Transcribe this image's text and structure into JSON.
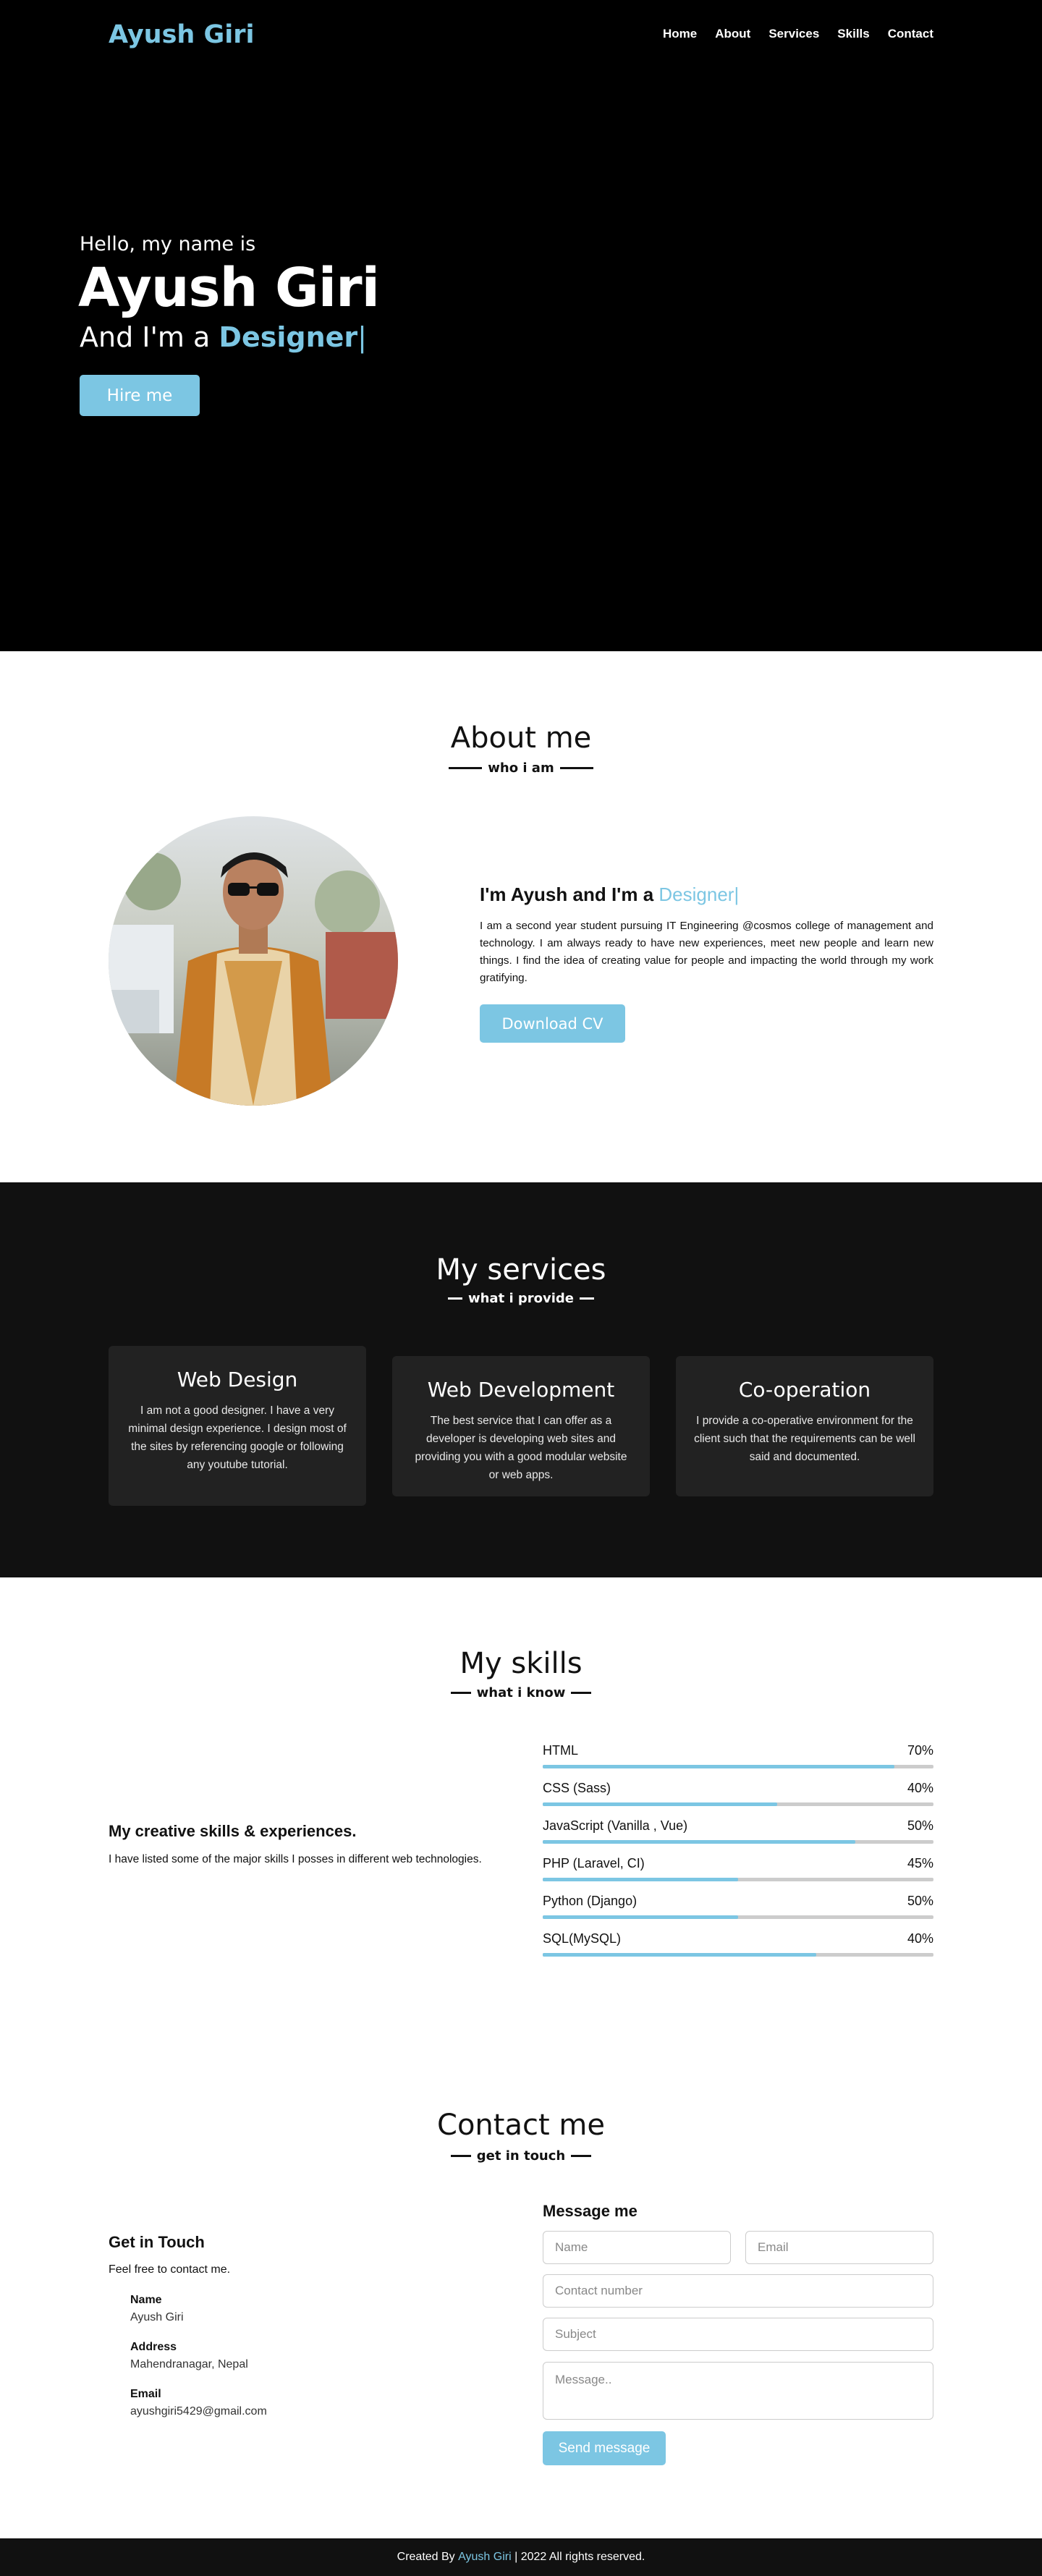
{
  "brand": {
    "name": "Ayush Giri",
    "accent": "#7cc6e3"
  },
  "nav": {
    "items": [
      "Home",
      "About",
      "Services",
      "Skills",
      "Contact"
    ]
  },
  "hero": {
    "greeting": "Hello, my name is",
    "name": "Ayush Giri",
    "role_prefix": "And I'm a",
    "role_typed": "Designer",
    "cursor": "|",
    "hire_label": "Hire me"
  },
  "about": {
    "title": "About me",
    "subtitle": "who i am",
    "heading_prefix": "I'm Ayush and I'm a",
    "heading_typed": "Designer|",
    "paragraph": "I am a second year student pursuing IT Engineering @cosmos college of management and technology. I am always ready to have new experiences, meet new people and learn new things. I find the idea of creating value for people and impacting the world through my work gratifying.",
    "cv_label": "Download CV"
  },
  "services": {
    "title": "My services",
    "subtitle": "what i provide",
    "cards": [
      {
        "title": "Web Design",
        "text": "I am not a good designer. I have a very minimal design experience. I design most of the sites by referencing google or following any youtube tutorial."
      },
      {
        "title": "Web Development",
        "text": "The best service that I can offer as a developer is developing web sites and providing you with a good modular website or web apps."
      },
      {
        "title": "Co-operation",
        "text": "I provide a co-operative environment for the client such that the requirements can be well said and documented."
      }
    ]
  },
  "skills": {
    "title": "My skills",
    "subtitle": "what i know",
    "heading": "My creative skills & experiences.",
    "paragraph": "I have listed some of the major skills I posses in different web technologies.",
    "items": [
      {
        "name": "HTML",
        "label": "70%",
        "percent": 90
      },
      {
        "name": "CSS (Sass)",
        "label": "40%",
        "percent": 60
      },
      {
        "name": "JavaScript (Vanilla , Vue)",
        "label": "50%",
        "percent": 80
      },
      {
        "name": "PHP (Laravel, CI)",
        "label": "45%",
        "percent": 50
      },
      {
        "name": "Python (Django)",
        "label": "50%",
        "percent": 50
      },
      {
        "name": "SQL(MySQL)",
        "label": "40%",
        "percent": 70
      }
    ]
  },
  "contact": {
    "title": "Contact me",
    "subtitle": "get in touch",
    "heading": "Get in Touch",
    "lead": "Feel free to contact me.",
    "info": [
      {
        "label": "Name",
        "value": "Ayush Giri"
      },
      {
        "label": "Address",
        "value": "Mahendranagar, Nepal"
      },
      {
        "label": "Email",
        "value": "ayushgiri5429@gmail.com"
      }
    ],
    "form_heading": "Message me",
    "placeholders": {
      "name": "Name",
      "email": "Email",
      "contact": "Contact number",
      "subject": "Subject",
      "message": "Message.."
    },
    "send_label": "Send message"
  },
  "footer": {
    "prefix": "Created By",
    "name": "Ayush Giri",
    "suffix": "| 2022 All rights reserved."
  }
}
